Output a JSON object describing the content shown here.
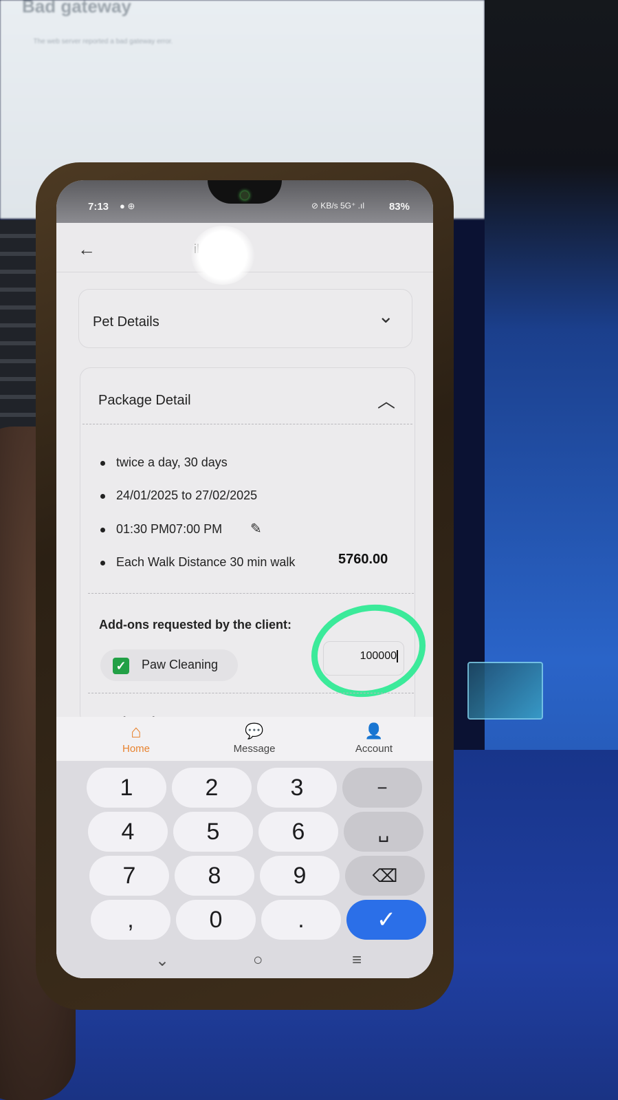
{
  "status_bar": {
    "time": "7:13",
    "notif_icons": "● ⊕",
    "mid_icons": "⊘ KB/s 5G⁺ .ıl",
    "battery": "83%"
  },
  "header": {
    "back_icon": "←",
    "title": "ils"
  },
  "pet_details": {
    "title": "Pet Details",
    "chevron": "⌄"
  },
  "package_detail": {
    "title": "Package Detail",
    "chevron": "︿",
    "items": [
      "twice a day, 30 days",
      "24/01/2025 to 27/02/2025",
      "01:30 PM07:00 PM",
      "Each Walk Distance 30 min walk"
    ],
    "price": "5760.00",
    "edit_icon": "✎"
  },
  "addons": {
    "label": "Add-ons requested by the client:",
    "item_label": "Paw Cleaning",
    "checked": true,
    "check_glyph": "✓",
    "input_value": "100000"
  },
  "total_cut_off": "Total Package Cost",
  "bottom_nav": [
    {
      "label": "Home",
      "icon": "⌂",
      "active": true,
      "color": "#e8832f"
    },
    {
      "label": "Message",
      "icon": "💬",
      "active": false,
      "color": "#444444"
    },
    {
      "label": "Account",
      "icon": "👤",
      "active": false,
      "color": "#444444"
    }
  ],
  "keyboard": {
    "keys": [
      "1",
      "2",
      "3",
      "−",
      "4",
      "5",
      "6",
      "␣",
      "7",
      "8",
      "9",
      "⌫",
      ",",
      "0",
      ".",
      "✓"
    ]
  },
  "system_nav": {
    "back": "⌄",
    "home": "○",
    "recents": "≡"
  },
  "background": {
    "monitor_title": "Bad gateway",
    "monitor_text": "The web server reported a bad gateway error."
  },
  "colors": {
    "annotation": "#3bea9a",
    "checkbox": "#22a046",
    "keyboard_done": "#2b6fe8",
    "nav_active": "#e8832f"
  }
}
